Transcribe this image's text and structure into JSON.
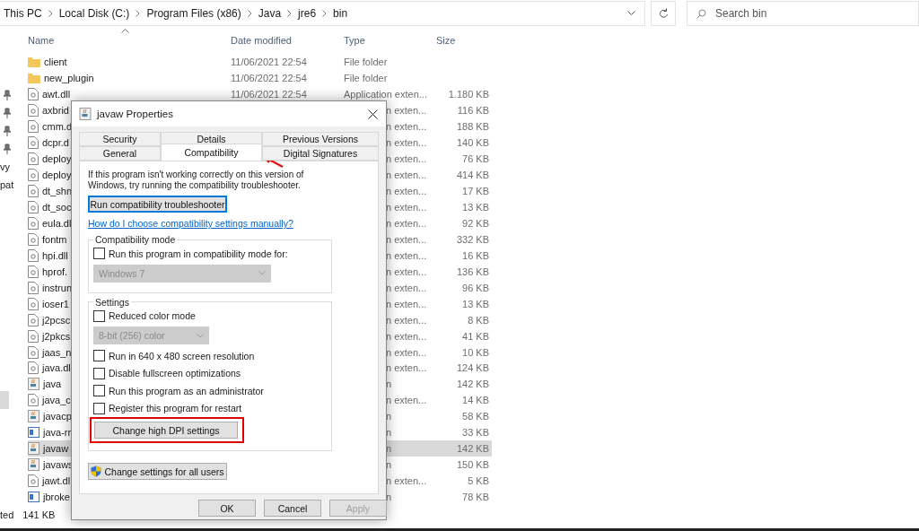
{
  "address_bar": {
    "path": [
      "This PC",
      "Local Disk (C:)",
      "Program Files (x86)",
      "Java",
      "jre6",
      "bin"
    ]
  },
  "search": {
    "placeholder": "Search bin"
  },
  "nav_pane": {
    "items": [
      {
        "kind": "pin"
      },
      {
        "kind": "pin"
      },
      {
        "kind": "pin"
      },
      {
        "kind": "pin"
      },
      {
        "label": "vy",
        "kind": "text"
      },
      {
        "label": "pat",
        "kind": "text"
      }
    ]
  },
  "table": {
    "columns": [
      "Name",
      "Date modified",
      "Type",
      "Size"
    ],
    "rows": [
      {
        "name": "client",
        "date": "11/06/2021 22:54",
        "type": "File folder",
        "size": "",
        "kind": "folder",
        "selected": false
      },
      {
        "name": "new_plugin",
        "date": "11/06/2021 22:54",
        "type": "File folder",
        "size": "",
        "kind": "folder",
        "selected": false
      },
      {
        "name": "awt.dll",
        "date": "11/06/2021 22:54",
        "type": "Application exten...",
        "size": "1.180 KB",
        "kind": "library",
        "selected": false
      },
      {
        "name": "axbrid",
        "type": "n exten...",
        "size": "116 KB",
        "kind": "library",
        "selected": false
      },
      {
        "name": "cmm.d",
        "type": "n exten...",
        "size": "188 KB",
        "kind": "library",
        "selected": false
      },
      {
        "name": "dcpr.d",
        "type": "n exten...",
        "size": "140 KB",
        "kind": "library",
        "selected": false
      },
      {
        "name": "deploy",
        "type": "n exten...",
        "size": "76 KB",
        "kind": "library",
        "selected": false
      },
      {
        "name": "deploy",
        "type": "n exten...",
        "size": "414 KB",
        "kind": "library",
        "selected": false
      },
      {
        "name": "dt_shn",
        "type": "n exten...",
        "size": "17 KB",
        "kind": "library",
        "selected": false
      },
      {
        "name": "dt_soc",
        "type": "n exten...",
        "size": "13 KB",
        "kind": "library",
        "selected": false
      },
      {
        "name": "eula.dl",
        "type": "n exten...",
        "size": "92 KB",
        "kind": "library",
        "selected": false
      },
      {
        "name": "fontm",
        "type": "n exten...",
        "size": "332 KB",
        "kind": "library",
        "selected": false
      },
      {
        "name": "hpi.dll",
        "type": "n exten...",
        "size": "16 KB",
        "kind": "library",
        "selected": false
      },
      {
        "name": "hprof.",
        "type": "n exten...",
        "size": "136 KB",
        "kind": "library",
        "selected": false
      },
      {
        "name": "instrun",
        "type": "n exten...",
        "size": "96 KB",
        "kind": "library",
        "selected": false
      },
      {
        "name": "ioser1",
        "type": "n exten...",
        "size": "13 KB",
        "kind": "library",
        "selected": false
      },
      {
        "name": "j2pcsc",
        "type": "n exten...",
        "size": "8 KB",
        "kind": "library",
        "selected": false
      },
      {
        "name": "j2pkcs",
        "type": "n exten...",
        "size": "41 KB",
        "kind": "library",
        "selected": false
      },
      {
        "name": "jaas_n",
        "type": "n exten...",
        "size": "10 KB",
        "kind": "library",
        "selected": false
      },
      {
        "name": "java.dl",
        "type": "n exten...",
        "size": "124 KB",
        "kind": "library",
        "selected": false
      },
      {
        "name": "java",
        "type": "n",
        "size": "142 KB",
        "kind": "java",
        "selected": false
      },
      {
        "name": "java_c",
        "type": "n exten...",
        "size": "14 KB",
        "kind": "library",
        "selected": false
      },
      {
        "name": "javacp",
        "type": "n",
        "size": "58 KB",
        "kind": "java",
        "selected": false
      },
      {
        "name": "java-rr",
        "type": "n",
        "size": "33 KB",
        "kind": "window",
        "selected": false
      },
      {
        "name": "javaw",
        "type": "n",
        "size": "142 KB",
        "kind": "java",
        "selected": true
      },
      {
        "name": "javaws",
        "type": "n",
        "size": "150 KB",
        "kind": "java",
        "selected": false
      },
      {
        "name": "jawt.dl",
        "type": "n exten...",
        "size": "5 KB",
        "kind": "library",
        "selected": false
      },
      {
        "name": "jbroke",
        "type": "n",
        "size": "78 KB",
        "kind": "window",
        "selected": false
      }
    ]
  },
  "status_bar": {
    "selection": "ted",
    "size": "141 KB"
  },
  "dialog": {
    "title": "javaw Properties",
    "tab_rows": [
      [
        {
          "label": "Security",
          "selected": false
        },
        {
          "label": "Details",
          "selected": false
        },
        {
          "label": "Previous Versions",
          "selected": false
        }
      ],
      [
        {
          "label": "General",
          "selected": false
        },
        {
          "label": "Compatibility",
          "selected": true
        },
        {
          "label": "Digital Signatures",
          "selected": false
        }
      ]
    ],
    "intro": "If this program isn't working correctly on this version of Windows, try running the compatibility troubleshooter.",
    "troubleshooter_button": "Run compatibility troubleshooter",
    "help_link": "How do I choose compatibility settings manually?",
    "compatibility_mode": {
      "title": "Compatibility mode",
      "checkbox": {
        "label": "Run this program in compatibility mode for:",
        "checked": false
      },
      "dropdown": {
        "value": "Windows 7",
        "disabled": true
      }
    },
    "settings": {
      "title": "Settings",
      "items": [
        {
          "kind": "checkbox",
          "label": "Reduced color mode",
          "checked": false
        },
        {
          "kind": "dropdown",
          "value": "8-bit (256) color",
          "disabled": true
        },
        {
          "kind": "checkbox",
          "label": "Run in 640 x 480 screen resolution",
          "checked": false
        },
        {
          "kind": "checkbox",
          "label": "Disable fullscreen optimizations",
          "checked": false
        },
        {
          "kind": "checkbox",
          "label": "Run this program as an administrator",
          "checked": false
        },
        {
          "kind": "checkbox",
          "label": "Register this program for restart",
          "checked": false
        },
        {
          "kind": "button",
          "label": "Change high DPI settings",
          "highlighted": true
        }
      ]
    },
    "all_users_button": "Change settings for all users",
    "buttons": [
      {
        "label": "OK",
        "disabled": false
      },
      {
        "label": "Cancel",
        "disabled": false
      },
      {
        "label": "Apply",
        "disabled": true
      }
    ]
  }
}
